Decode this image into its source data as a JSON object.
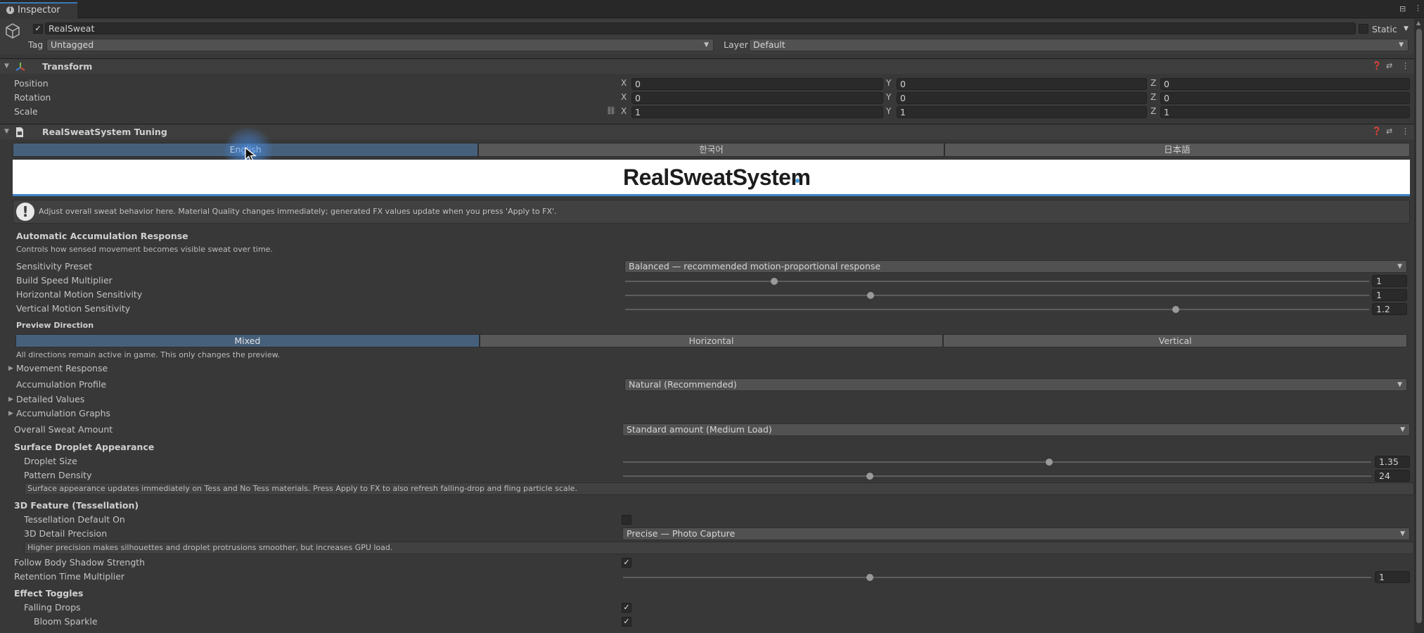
{
  "window": {
    "tab_label": "Inspector"
  },
  "gameobject": {
    "active": "✓",
    "name": "RealSweat",
    "static_label": "Static",
    "tag_label": "Tag",
    "tag_value": "Untagged",
    "layer_label": "Layer",
    "layer_value": "Default"
  },
  "transform": {
    "title": "Transform",
    "position_label": "Position",
    "rotation_label": "Rotation",
    "scale_label": "Scale",
    "position": {
      "x": "0",
      "y": "0",
      "z": "0"
    },
    "rotation": {
      "x": "0",
      "y": "0",
      "z": "0"
    },
    "scale": {
      "x": "1",
      "y": "1",
      "z": "1"
    },
    "axis": {
      "x": "X",
      "y": "Y",
      "z": "Z"
    }
  },
  "component": {
    "title": "RealSweatSystem Tuning",
    "languages": [
      "English",
      "한국어",
      "日本語"
    ],
    "logo_text": "RealSweatSystem",
    "info_text": "Adjust overall sweat behavior here. Material Quality changes immediately; generated FX values update when you press 'Apply to FX'.",
    "auto_title": "Automatic Accumulation Response",
    "auto_desc": "Controls how sensed movement becomes visible sweat over time.",
    "sensitivity_label": "Sensitivity Preset",
    "sensitivity_value": "Balanced — recommended motion-proportional response",
    "build_speed_label": "Build Speed Multiplier",
    "build_speed_value": "1",
    "build_speed_level": 0.2,
    "horizontal_label": "Horizontal Motion Sensitivity",
    "horizontal_value": "1",
    "horizontal_level": 0.33,
    "vertical_label": "Vertical Motion Sensitivity",
    "vertical_value": "1.2",
    "vertical_level": 0.74,
    "preview_title": "Preview Direction",
    "preview_tabs": [
      "Mixed",
      "Horizontal",
      "Vertical"
    ],
    "preview_note": "All directions remain active in game. This only changes the preview.",
    "movement_response": "Movement Response",
    "accum_profile_label": "Accumulation Profile",
    "accum_profile_value": "Natural (Recommended)",
    "detailed_values": "Detailed Values",
    "accum_graphs": "Accumulation Graphs",
    "overall_label": "Overall Sweat Amount",
    "overall_value": "Standard amount (Medium Load)",
    "surface_title": "Surface Droplet Appearance",
    "droplet_size_label": "Droplet Size",
    "droplet_size_value": "1.35",
    "droplet_size_level": 0.57,
    "pattern_density_label": "Pattern Density",
    "pattern_density_value": "24",
    "pattern_density_level": 0.33,
    "surface_note": "Surface appearance updates immediately on Tess and No Tess materials. Press Apply to FX to also refresh falling-drop and fling particle scale.",
    "tess_title": "3D Feature (Tessellation)",
    "tess_default_label": "Tessellation Default On",
    "detail_precision_label": "3D Detail Precision",
    "detail_precision_value": "Precise — Photo Capture",
    "detail_note": "Higher precision makes silhouettes and droplet protrusions smoother, but increases GPU load.",
    "follow_shadow_label": "Follow Body Shadow Strength",
    "follow_shadow_check": "✓",
    "retention_label": "Retention Time Multiplier",
    "retention_value": "1",
    "retention_level": 0.33,
    "effects_title": "Effect Toggles",
    "falling_drops_label": "Falling Drops",
    "falling_drops_check": "✓",
    "bloom_sparkle_label": "Bloom Sparkle",
    "bloom_sparkle_check": "✓"
  }
}
